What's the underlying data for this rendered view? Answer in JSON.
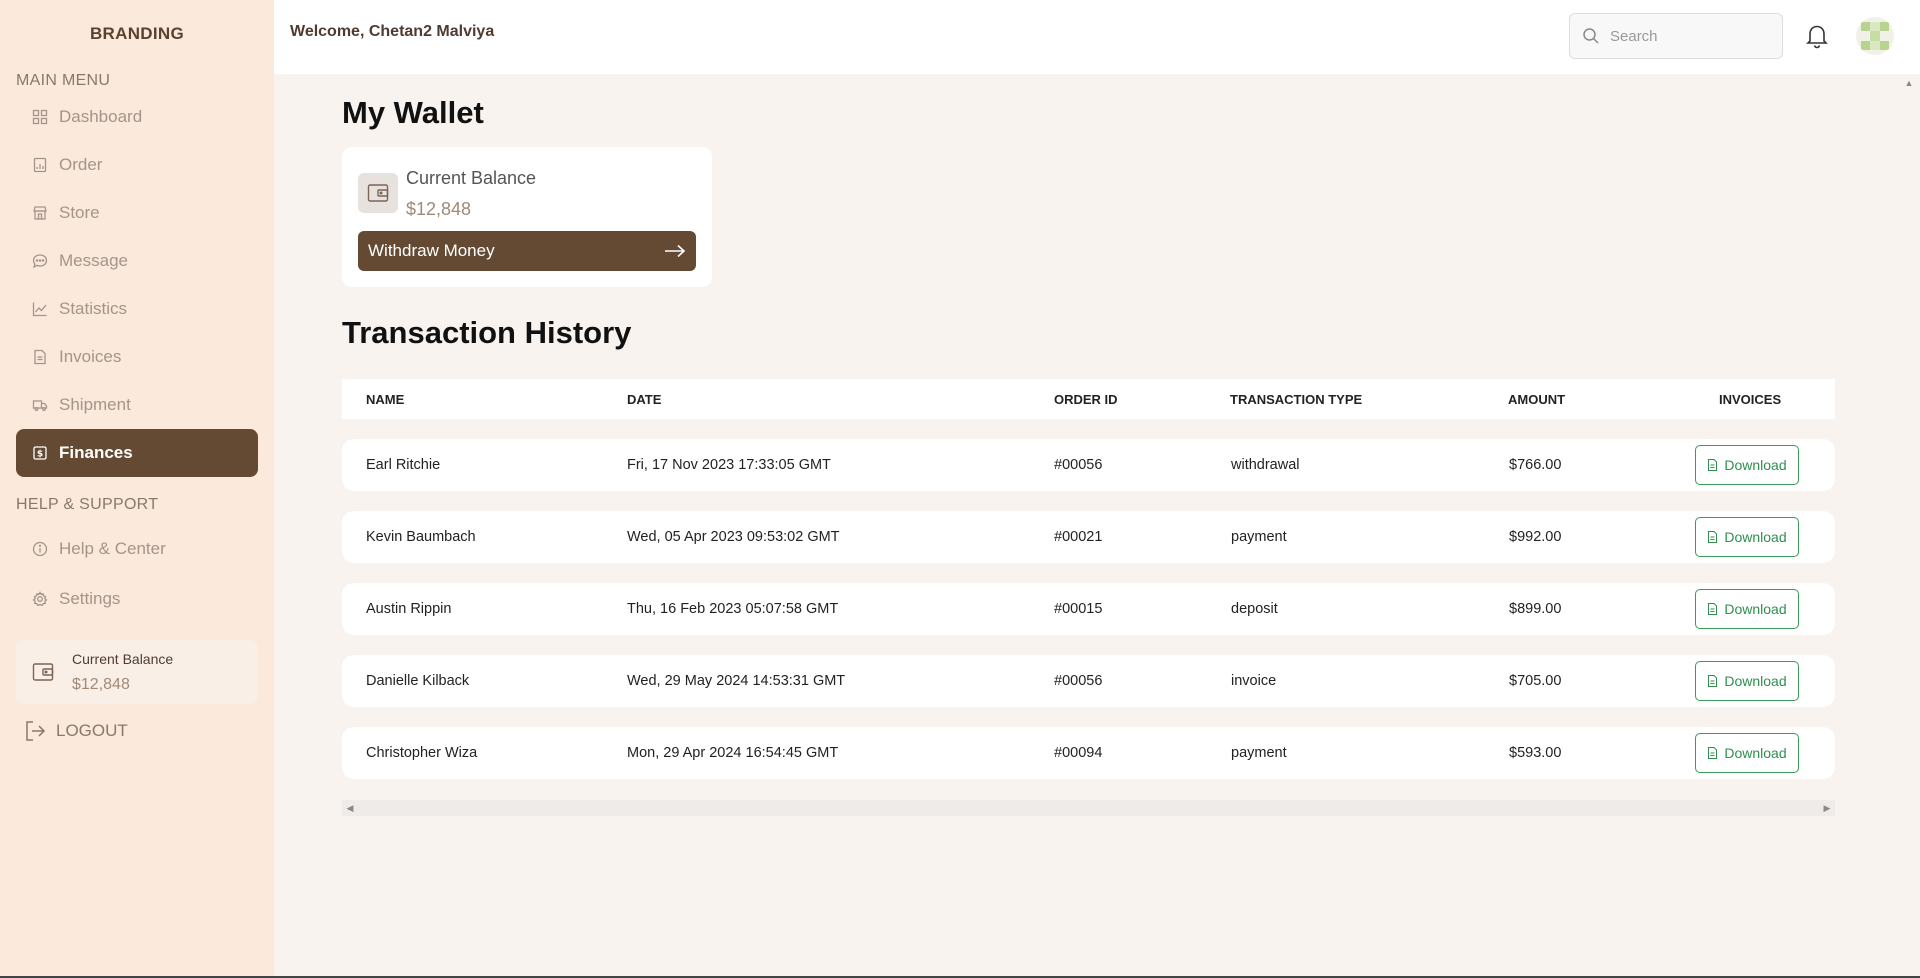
{
  "brand": "BRANDING",
  "sidebar": {
    "main_menu_label": "MAIN MENU",
    "items": [
      {
        "label": "Dashboard",
        "icon": "grid-icon"
      },
      {
        "label": "Order",
        "icon": "clipboard-icon"
      },
      {
        "label": "Store",
        "icon": "store-icon"
      },
      {
        "label": "Message",
        "icon": "chat-icon"
      },
      {
        "label": "Statistics",
        "icon": "chart-line-icon"
      },
      {
        "label": "Invoices",
        "icon": "document-icon"
      },
      {
        "label": "Shipment",
        "icon": "truck-icon"
      },
      {
        "label": "Finances",
        "icon": "dollar-icon",
        "active": true
      }
    ],
    "support_label": "HELP & SUPPORT",
    "support_items": [
      {
        "label": "Help & Center",
        "icon": "info-icon"
      },
      {
        "label": "Settings",
        "icon": "gear-icon"
      }
    ],
    "balance": {
      "label": "Current Balance",
      "amount": "$12,848"
    },
    "logout_label": "LOGOUT"
  },
  "header": {
    "welcome": "Welcome, Chetan2 Malviya",
    "search_placeholder": "Search"
  },
  "wallet": {
    "title": "My Wallet",
    "balance_label": "Current Balance",
    "balance_amount": "$12,848",
    "withdraw_label": "Withdraw Money"
  },
  "transactions": {
    "title": "Transaction History",
    "columns": [
      "NAME",
      "DATE",
      "ORDER ID",
      "TRANSACTION TYPE",
      "AMOUNT",
      "INVOICES"
    ],
    "download_label": "Download",
    "rows": [
      {
        "name": "Earl Ritchie",
        "date": "Fri, 17 Nov 2023 17:33:05 GMT",
        "order_id": "#00056",
        "type": "withdrawal",
        "amount": "$766.00"
      },
      {
        "name": "Kevin Baumbach",
        "date": "Wed, 05 Apr 2023 09:53:02 GMT",
        "order_id": "#00021",
        "type": "payment",
        "amount": "$992.00"
      },
      {
        "name": "Austin Rippin",
        "date": "Thu, 16 Feb 2023 05:07:58 GMT",
        "order_id": "#00015",
        "type": "deposit",
        "amount": "$899.00"
      },
      {
        "name": "Danielle Kilback",
        "date": "Wed, 29 May 2024 14:53:31 GMT",
        "order_id": "#00056",
        "type": "invoice",
        "amount": "$705.00"
      },
      {
        "name": "Christopher Wiza",
        "date": "Mon, 29 Apr 2024 16:54:45 GMT",
        "order_id": "#00094",
        "type": "payment",
        "amount": "$593.00"
      }
    ]
  },
  "colors": {
    "accent": "#644a33",
    "sidebar_bg": "#fbe9dc",
    "page_bg": "#f8f3ef",
    "download_green": "#2f8f4f"
  }
}
